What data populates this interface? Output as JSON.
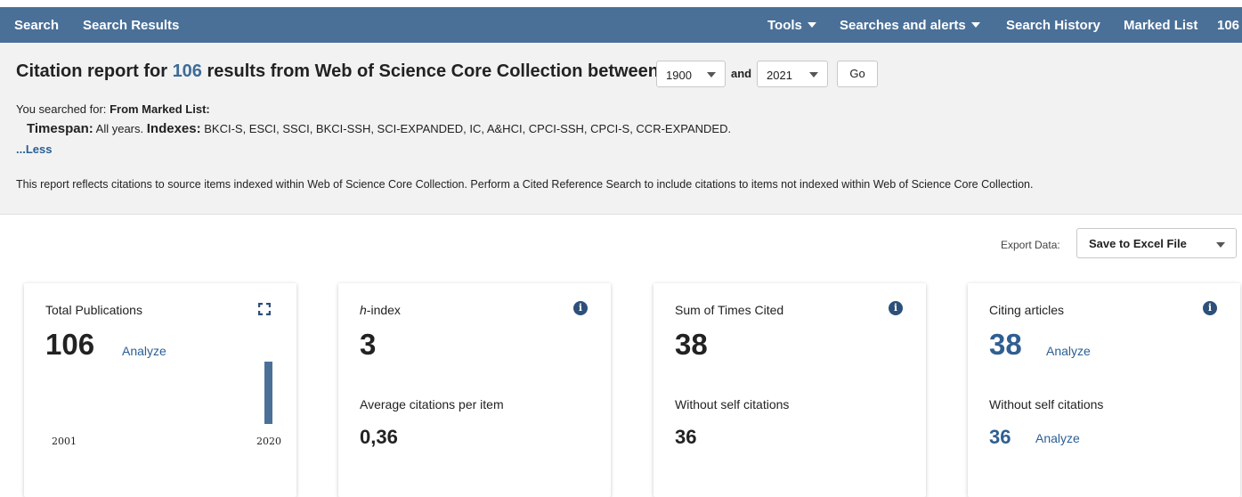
{
  "topbar": {
    "search": "Search",
    "search_results": "Search Results",
    "tools": "Tools",
    "searches_alerts": "Searches and alerts",
    "search_history": "Search History",
    "marked_list": "Marked List",
    "marked_count": "106"
  },
  "report": {
    "title_prefix": "Citation report for",
    "count": "106",
    "title_suffix": "results from Web of Science Core Collection between",
    "year_from": "1900",
    "and_label": "and",
    "year_to": "2021",
    "go_label": "Go",
    "searched_for_label": "You searched for:",
    "searched_for_value": "From Marked List:",
    "timespan_label": "Timespan:",
    "timespan_value": "All years.",
    "indexes_label": "Indexes:",
    "indexes_value": "BKCI-S, ESCI, SSCI, BKCI-SSH, SCI-EXPANDED, IC, A&HCI, CPCI-SSH, CPCI-S, CCR-EXPANDED.",
    "less_link": "...Less",
    "note": "This report reflects citations to source items indexed within Web of Science Core Collection. Perform a Cited Reference Search to include citations to items not indexed within Web of Science Core Collection."
  },
  "export": {
    "label": "Export Data:",
    "selected": "Save to Excel File"
  },
  "cards": {
    "total": {
      "label": "Total Publications",
      "value": "106",
      "analyze": "Analyze",
      "year_start": "2001",
      "year_end": "2020",
      "icon": "expand-icon"
    },
    "hindex": {
      "label_prefix": "h",
      "label_suffix": "-index",
      "value": "3",
      "sublabel": "Average citations per item",
      "subvalue": "0,36",
      "icon": "info-icon"
    },
    "sum": {
      "label": "Sum of Times Cited",
      "value": "38",
      "sublabel": "Without self citations",
      "subvalue": "36",
      "icon": "info-icon"
    },
    "citing": {
      "label": "Citing articles",
      "value": "38",
      "analyze": "Analyze",
      "sublabel": "Without self citations",
      "subvalue": "36",
      "sub_analyze": "Analyze",
      "icon": "info-icon"
    }
  },
  "colors": {
    "topbar": "#4a7098",
    "link": "#2a5f95",
    "info_icon": "#2d5079"
  }
}
